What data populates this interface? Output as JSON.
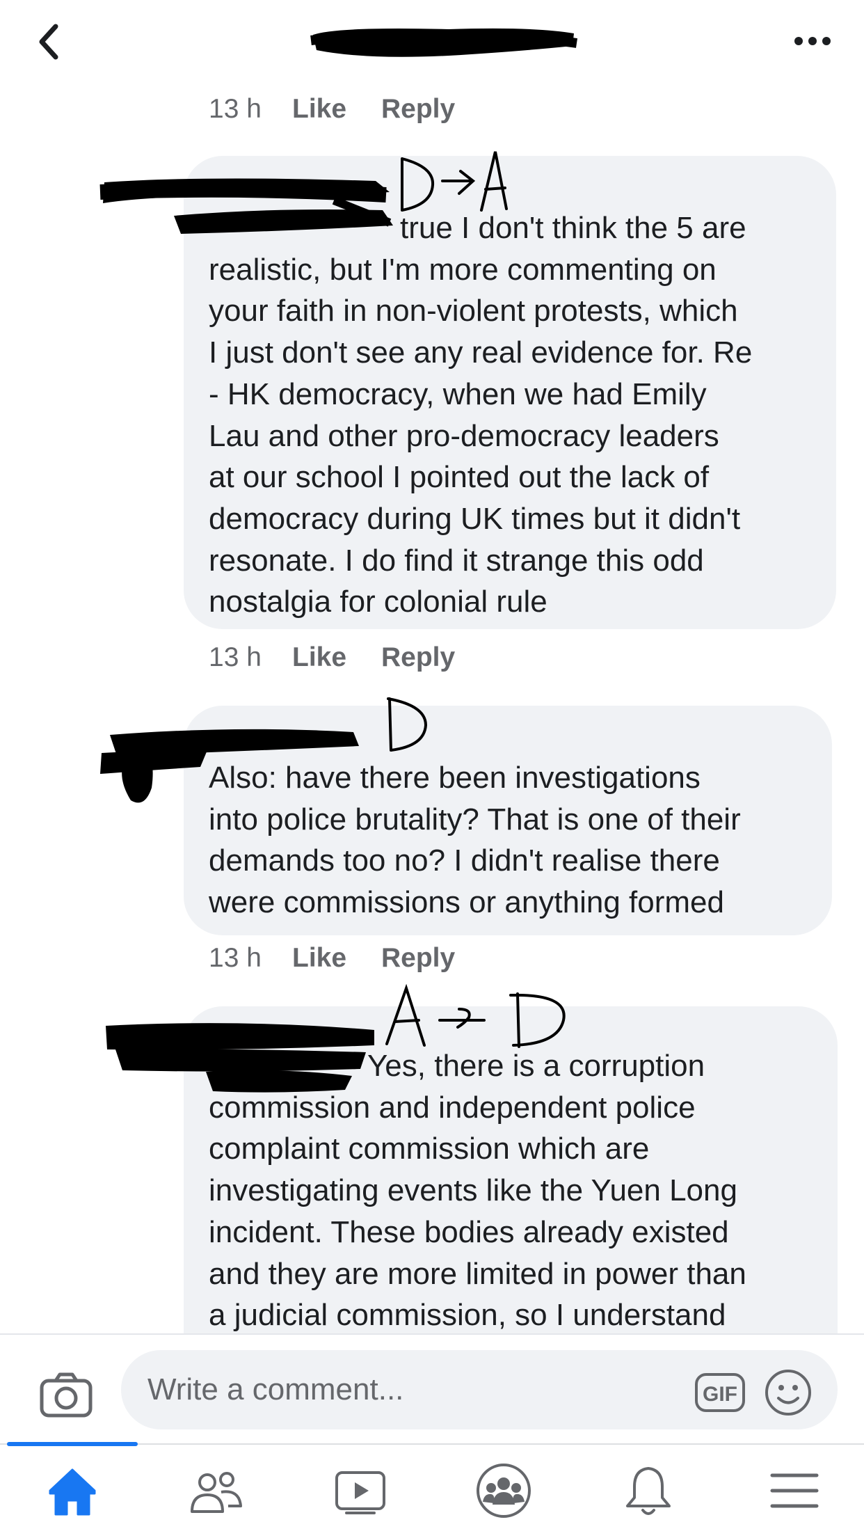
{
  "header": {
    "back_icon": "chevron-left-icon",
    "more_icon": "more-dots-icon"
  },
  "comments": [
    {
      "meta": {
        "time": "13 h",
        "like": "Like",
        "reply": "Reply"
      }
    },
    {
      "annotation": "D→A",
      "lines": [
        "true I don't think the 5 are",
        "realistic, but I'm more commenting on",
        "your faith in non-violent protests, which",
        "I just don't see any real evidence for. Re",
        "- HK democracy, when we had Emily",
        "Lau and other pro-democracy leaders",
        "at our school I pointed out the lack of",
        "democracy during UK times but it didn't",
        "resonate. I do find it strange this odd",
        "nostalgia for colonial rule"
      ],
      "meta": {
        "time": "13 h",
        "like": "Like",
        "reply": "Reply"
      }
    },
    {
      "annotation": "D",
      "lines": [
        "Also: have there been investigations",
        "into police brutality? That is one of their",
        "demands too no? I didn't realise there",
        "were commissions or anything formed"
      ],
      "meta": {
        "time": "13 h",
        "like": "Like",
        "reply": "Reply"
      }
    },
    {
      "annotation": "A→D",
      "lines": [
        "Yes, there is a corruption",
        "commission and independent police",
        "complaint commission which are",
        "investigating events like the Yuen Long",
        "incident. These bodies already existed",
        "and they are more limited in power than",
        "a judicial commission, so I understand"
      ]
    }
  ],
  "composer": {
    "placeholder": "Write a comment...",
    "camera_icon": "camera-icon",
    "gif_label": "GIF",
    "emoji_icon": "emoji-icon"
  },
  "tabbar": {
    "items": [
      "home-icon",
      "friends-icon",
      "watch-icon",
      "groups-icon",
      "notifications-icon",
      "menu-icon"
    ],
    "active_color": "#1877f2",
    "inactive_color": "#65676b"
  }
}
